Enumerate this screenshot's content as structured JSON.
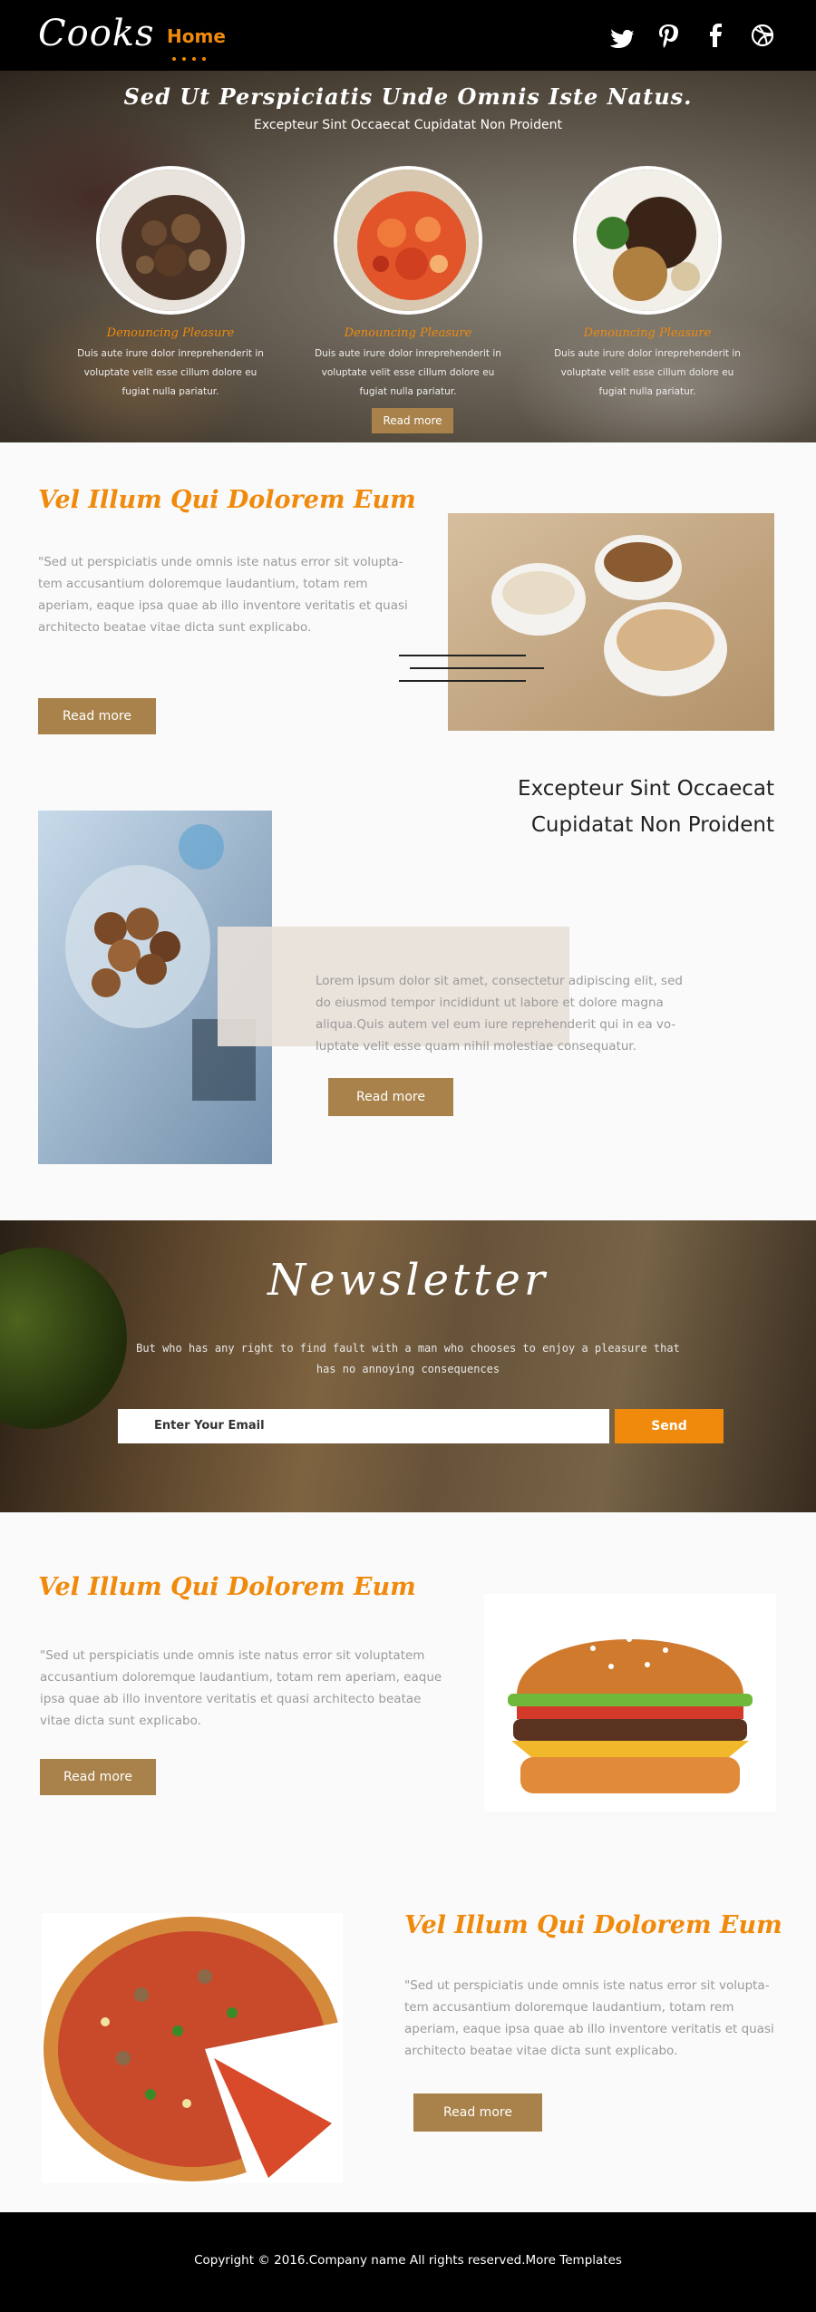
{
  "header": {
    "logo": "Cooks",
    "nav_home": "Home",
    "social_icons": [
      "twitter-icon",
      "pinterest-icon",
      "facebook-icon",
      "dribbble-icon"
    ]
  },
  "hero": {
    "title": "Sed Ut Perspiciatis Unde Omnis Iste Natus.",
    "subtitle": "Excepteur Sint Occaecat Cupidatat Non Proident",
    "dishes": [
      {
        "title": "Denouncing Pleasure",
        "text": "Duis aute irure dolor inreprehenderit in voluptate velit esse cillum dolore eu fugiat nulla pariatur."
      },
      {
        "title": "Denouncing Pleasure",
        "text": "Duis aute irure dolor inreprehenderit in voluptate velit esse cillum dolore eu fugiat nulla pariatur."
      },
      {
        "title": "Denouncing Pleasure",
        "text": "Duis aute irure dolor inreprehenderit in voluptate velit esse cillum dolore eu fugiat nulla pariatur."
      }
    ],
    "button": "Read more"
  },
  "section1": {
    "title": "Vel Illum Qui Dolorem Eum",
    "text": "\"Sed ut perspiciatis unde omnis iste natus error sit volupta-tem accusantium doloremque laudantium, totam rem aperiam, eaque ipsa quae ab illo inventore veritatis et quasi architecto beatae vitae dicta sunt explicabo.",
    "button": "Read more"
  },
  "section2": {
    "heading_line1": "Excepteur Sint Occaecat",
    "heading_line2": "Cupidatat Non Proident",
    "text": "Lorem ipsum dolor sit amet, consectetur adipiscing elit, sed do eiusmod tempor incididunt ut labore et dolore magna aliqua.Quis autem vel eum iure reprehenderit qui in ea vo-luptate velit esse quam nihil molestiae consequatur.",
    "button": "Read more"
  },
  "newsletter": {
    "title": "Newsletter",
    "text": "But who has any right to find fault with a man who chooses to enjoy a pleasure that has no annoying consequences",
    "placeholder": "Enter Your Email",
    "send": "Send"
  },
  "section3": {
    "title": "Vel Illum Qui Dolorem Eum",
    "text": "\"Sed ut perspiciatis unde omnis iste natus error sit voluptatem accusantium doloremque laudantium, totam rem aperiam, eaque ipsa quae ab illo inventore veritatis et quasi architecto beatae vitae dicta sunt explicabo.",
    "button": "Read more"
  },
  "section4": {
    "title": "Vel Illum Qui Dolorem Eum",
    "text": "\"Sed ut perspiciatis unde omnis iste natus error sit volupta-tem accusantium doloremque laudantium, totam rem aperiam, eaque ipsa quae ab illo inventore veritatis et quasi architecto beatae vitae dicta sunt explicabo.",
    "button": "Read more"
  },
  "footer": {
    "copyright": "Copyright © 2016.Company name All rights reserved.More Templates"
  },
  "colors": {
    "accent": "#f08a0c",
    "button": "#a8824a",
    "header_bg": "#000000"
  }
}
